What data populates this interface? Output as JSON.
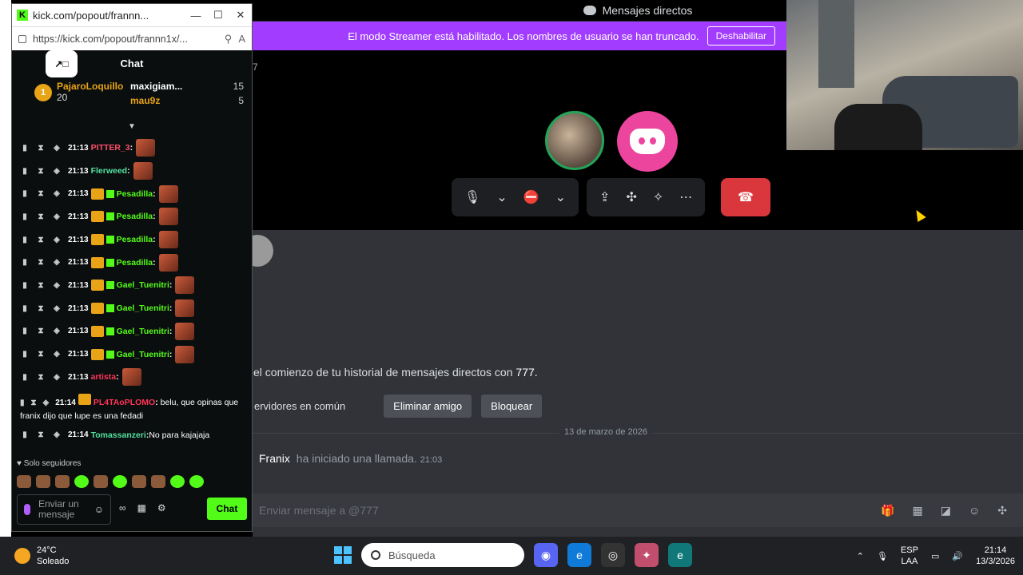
{
  "discord": {
    "window_title": "Mensajes directos",
    "streamer_banner": "El modo Streamer está habilitado. Los nombres de usuario se han truncado.",
    "streamer_disable": "Deshabilitar",
    "history_prefix": "el comienzo de tu historial de mensajes directos con ",
    "history_user": "777.",
    "servers_common": "ervidores en común",
    "remove_friend": "Eliminar amigo",
    "block": "Bloquear",
    "date_divider": "13 de marzo de 2026",
    "call_user": "Franix",
    "call_text": "ha iniciado una llamada.",
    "call_time": "21:03",
    "input_placeholder": "Enviar mensaje a @777",
    "header_glyph": "7"
  },
  "kick": {
    "title": "kick.com/popout/frannn...",
    "url": "https://kick.com/popout/frannn1x/...",
    "chat_header": "Chat",
    "leader_main": {
      "name": "PajaroLoquillo",
      "count": "20",
      "rank": "1"
    },
    "leaders": [
      {
        "name": "maxigiam...",
        "count": "15"
      },
      {
        "name": "mau9z",
        "count": "5"
      }
    ],
    "messages": [
      {
        "time": "21:13",
        "user": "PITTER_3",
        "color": "#ff4f6a",
        "badges": 0,
        "body": ""
      },
      {
        "time": "21:13",
        "user": "Flerweed",
        "color": "#53e0a0",
        "badges": 0,
        "body": ""
      },
      {
        "time": "21:13",
        "user": "Pesadilla",
        "color": "#53fc18",
        "badges": 2,
        "body": ""
      },
      {
        "time": "21:13",
        "user": "Pesadilla",
        "color": "#53fc18",
        "badges": 2,
        "body": ""
      },
      {
        "time": "21:13",
        "user": "Pesadilla",
        "color": "#53fc18",
        "badges": 2,
        "body": ""
      },
      {
        "time": "21:13",
        "user": "Pesadilla",
        "color": "#53fc18",
        "badges": 2,
        "body": ""
      },
      {
        "time": "21:13",
        "user": "Gael_Tuenitri",
        "color": "#53fc18",
        "badges": 2,
        "body": ""
      },
      {
        "time": "21:13",
        "user": "Gael_Tuenitri",
        "color": "#53fc18",
        "badges": 2,
        "body": ""
      },
      {
        "time": "21:13",
        "user": "Gael_Tuenitri",
        "color": "#53fc18",
        "badges": 2,
        "body": ""
      },
      {
        "time": "21:13",
        "user": "Gael_Tuenitri",
        "color": "#53fc18",
        "badges": 2,
        "body": ""
      },
      {
        "time": "21:13",
        "user": "artista",
        "color": "#ff3355",
        "badges": 0,
        "body": ""
      }
    ],
    "long_msg": {
      "time": "21:14",
      "user": "PL4TAoPLOMO",
      "color": "#ff3355",
      "body": "belu, que opinas que franix dijo que lupe es una fedadi"
    },
    "last_msg": {
      "time": "21:14",
      "user": "Tomassanzeri",
      "color": "#53e0a0",
      "body": "No para kajajaja"
    },
    "followers_only": "Solo seguidores",
    "input_placeholder": "Enviar un mensaje",
    "chat_button": "Chat"
  },
  "taskbar": {
    "temp": "24°C",
    "weather": "Soleado",
    "search": "Búsqueda",
    "lang_top": "ESP",
    "lang_bottom": "LAA",
    "time": "21:14",
    "date": "13/3/2026"
  }
}
